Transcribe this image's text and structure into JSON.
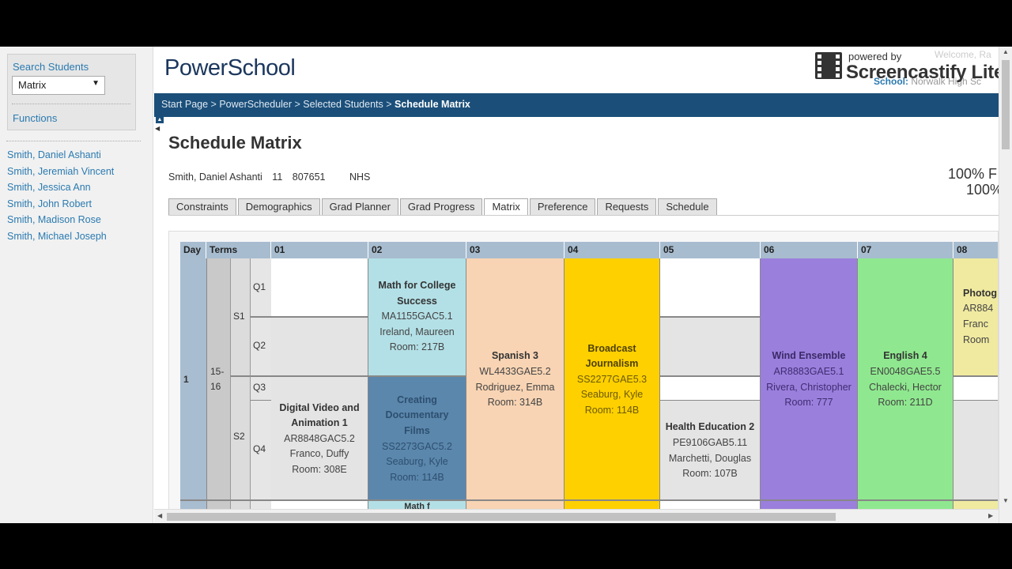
{
  "sidebar": {
    "search_label": "Search Students",
    "select_value": "Matrix",
    "functions_label": "Functions",
    "students": [
      "Smith, Daniel Ashanti",
      "Smith, Jeremiah Vincent",
      "Smith, Jessica Ann",
      "Smith, John Robert",
      "Smith, Madison Rose",
      "Smith, Michael Joseph"
    ]
  },
  "header": {
    "logo": "PowerSchool",
    "welcome": "Welcome, Ra",
    "school_label": "School:",
    "school_name": "Norwalk High Sc",
    "watermark_small": "powered by",
    "watermark_big": "Screencastify Lite"
  },
  "breadcrumb": {
    "items": [
      "Start Page",
      "PowerScheduler",
      "Selected Students"
    ],
    "separator": " > ",
    "current": "Schedule Matrix"
  },
  "page": {
    "title": "Schedule Matrix",
    "student_name": "Smith, Daniel Ashanti",
    "grade": "11",
    "student_id": "807651",
    "school_code": "NHS",
    "progress_a": "100% F",
    "progress_b": "100%"
  },
  "tabs": [
    {
      "label": "Constraints",
      "active": false
    },
    {
      "label": "Demographics",
      "active": false
    },
    {
      "label": "Grad Planner",
      "active": false
    },
    {
      "label": "Grad Progress",
      "active": false
    },
    {
      "label": "Matrix",
      "active": true
    },
    {
      "label": "Preference",
      "active": false
    },
    {
      "label": "Requests",
      "active": false
    },
    {
      "label": "Schedule",
      "active": false
    }
  ],
  "matrix": {
    "headers": {
      "day": "Day",
      "terms": "Terms",
      "periods": [
        "01",
        "02",
        "03",
        "04",
        "05",
        "06",
        "07",
        "08"
      ]
    },
    "day": "1",
    "term": "15-\n16",
    "semesters": [
      "S1",
      "S2"
    ],
    "quarters": [
      "Q1",
      "Q2",
      "Q3",
      "Q4"
    ],
    "courses": {
      "p01": {
        "name": "Digital Video and Animation 1",
        "code": "AR8848GAC5.2",
        "teacher": "Franco, Duffy",
        "room": "Room: 308E",
        "color": "#e4e4e4"
      },
      "p02a": {
        "name": "Math for College Success",
        "code": "MA1155GAC5.1",
        "teacher": "Ireland, Maureen",
        "room": "Room: 217B",
        "color": "#b3e0e6"
      },
      "p02b": {
        "name": "Creating Documentary Films",
        "code": "SS2273GAC5.2",
        "teacher": "Seaburg, Kyle",
        "room": "Room: 114B",
        "color": "#5b87ad"
      },
      "p03": {
        "name": "Spanish 3",
        "code": "WL4433GAE5.2",
        "teacher": "Rodriguez, Emma",
        "room": "Room: 314B",
        "color": "#f8d4b4"
      },
      "p04": {
        "name": "Broadcast Journalism",
        "code": "SS2277GAE5.3",
        "teacher": "Seaburg, Kyle",
        "room": "Room: 114B",
        "color": "#ffd000"
      },
      "p05": {
        "name": "Health Education 2",
        "code": "PE9106GAB5.11",
        "teacher": "Marchetti, Douglas",
        "room": "Room: 107B",
        "color": "#e4e4e4"
      },
      "p06": {
        "name": "Wind Ensemble",
        "code": "AR8883GAE5.1",
        "teacher": "Rivera, Christopher",
        "room": "Room: 777",
        "color": "#9b7fdd"
      },
      "p07": {
        "name": "English 4",
        "code": "EN0048GAE5.5",
        "teacher": "Chalecki, Hector",
        "room": "Room: 211D",
        "color": "#8fe88f"
      },
      "p08": {
        "name": "Photog",
        "code": "AR884",
        "teacher": "Franc",
        "room": "Room",
        "color": "#f0eaa0"
      }
    },
    "next_row_partial": "Math f"
  }
}
